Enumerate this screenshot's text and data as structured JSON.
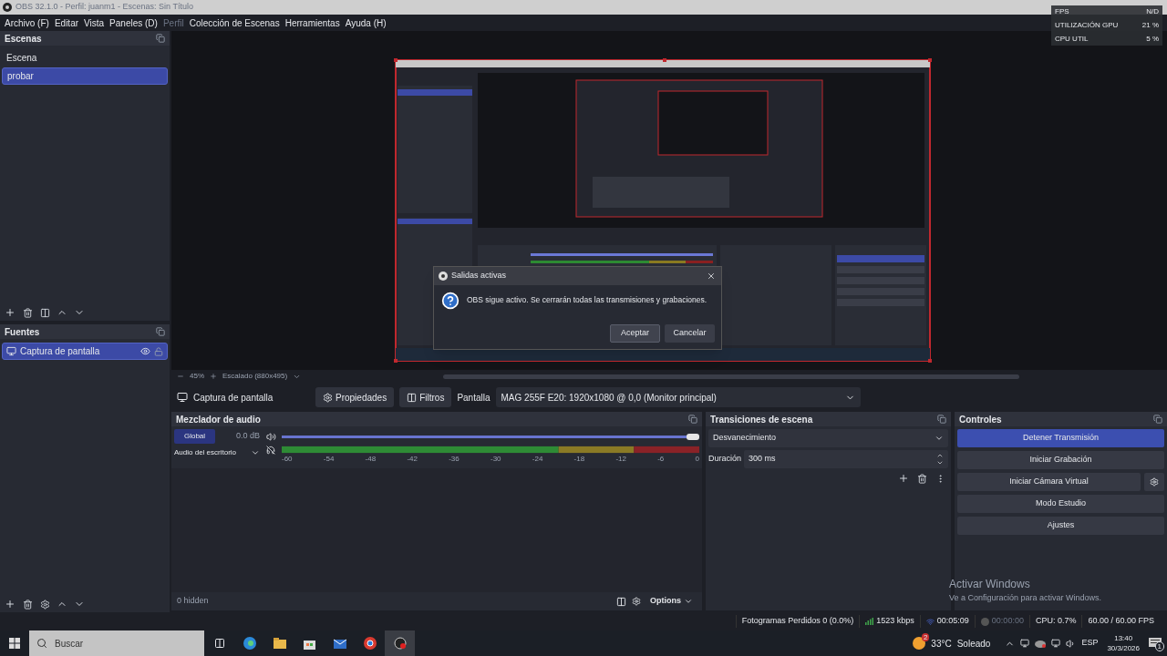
{
  "window": {
    "title": "OBS 32.1.0 - Perfil: juanm1 - Escenas: Sin Título"
  },
  "menu": [
    {
      "label": "Archivo (F)",
      "disabled": false
    },
    {
      "label": "Editar",
      "disabled": false
    },
    {
      "label": "Vista",
      "disabled": false
    },
    {
      "label": "Paneles (D)",
      "disabled": false
    },
    {
      "label": "Perfil",
      "disabled": true
    },
    {
      "label": "Colección de Escenas",
      "disabled": false
    },
    {
      "label": "Herramientas",
      "disabled": false
    },
    {
      "label": "Ayuda (H)",
      "disabled": false
    }
  ],
  "stats_overlay": [
    {
      "label": "FPS",
      "value": "N/D"
    },
    {
      "label": "UTILIZACIÓN GPU",
      "value": "21 %"
    },
    {
      "label": "CPU UTIL",
      "value": "5 %"
    }
  ],
  "scenes": {
    "title": "Escenas",
    "items": [
      {
        "label": "Escena",
        "selected": false
      },
      {
        "label": "probar",
        "selected": true
      }
    ]
  },
  "sources": {
    "title": "Fuentes",
    "items": [
      {
        "label": "Captura de pantalla",
        "selected": true,
        "visible": true,
        "locked": false
      }
    ]
  },
  "preview": {
    "zoom": "45%",
    "scaling": "Escalado (880x495)"
  },
  "dialog": {
    "title": "Salidas activas",
    "message": "OBS sigue activo. Se cerrarán todas las transmisiones y grabaciones.",
    "buttons": [
      {
        "label": "Aceptar",
        "selected": true
      },
      {
        "label": "Cancelar",
        "selected": false
      }
    ]
  },
  "source_toolbar": {
    "source": "Captura de pantalla",
    "properties": "Propiedades",
    "filters": "Filtros",
    "display_label": "Pantalla",
    "display_value": "MAG 255F E20: 1920x1080 @ 0,0 (Monitor principal)"
  },
  "audio_mixer": {
    "title": "Mezclador de audio",
    "channels": [
      {
        "tag": "Global",
        "name": "Audio del escritorio",
        "reading": "0.0 dB",
        "level": 1,
        "muted": false,
        "monitor_off": true
      }
    ],
    "meter_ticks": [
      "-60",
      "-54",
      "-48",
      "-42",
      "-36",
      "-30",
      "-24",
      "-18",
      "-12",
      "-6",
      "0"
    ],
    "hidden": "0 hidden",
    "options": "Options"
  },
  "transitions": {
    "title": "Transiciones de escena",
    "selected": "Desvanecimiento",
    "duration_label": "Duración",
    "duration": "300 ms"
  },
  "controls": {
    "title": "Controles",
    "buttons": [
      {
        "label": "Detener Transmisión",
        "selected": true,
        "kind": "plain"
      },
      {
        "label": "Iniciar Grabación",
        "selected": false,
        "kind": "plain"
      },
      {
        "label": "Iniciar Cámara Virtual",
        "selected": false,
        "kind": "with_settings"
      },
      {
        "label": "Modo Estudio",
        "selected": false,
        "kind": "plain"
      },
      {
        "label": "Ajustes",
        "selected": false,
        "kind": "plain"
      }
    ]
  },
  "status_bar": {
    "dropped": "Fotogramas Perdidos 0 (0.0%)",
    "bitrate": "1523 kbps",
    "stream_time": "00:05:09",
    "recording_time": "00:00:00",
    "cpu": "CPU: 0.7%",
    "fps": "60.00 / 60.00 FPS"
  },
  "activation": {
    "title": "Activar Windows",
    "subtitle": "Ve a Configuración para activar Windows."
  },
  "taskbar": {
    "search_placeholder": "Buscar",
    "weather_badge": "2",
    "temperature": "33°C",
    "weather": "Soleado",
    "language": "ESP",
    "time": "13:40",
    "date": "30/3/2026",
    "notifications": "1"
  }
}
